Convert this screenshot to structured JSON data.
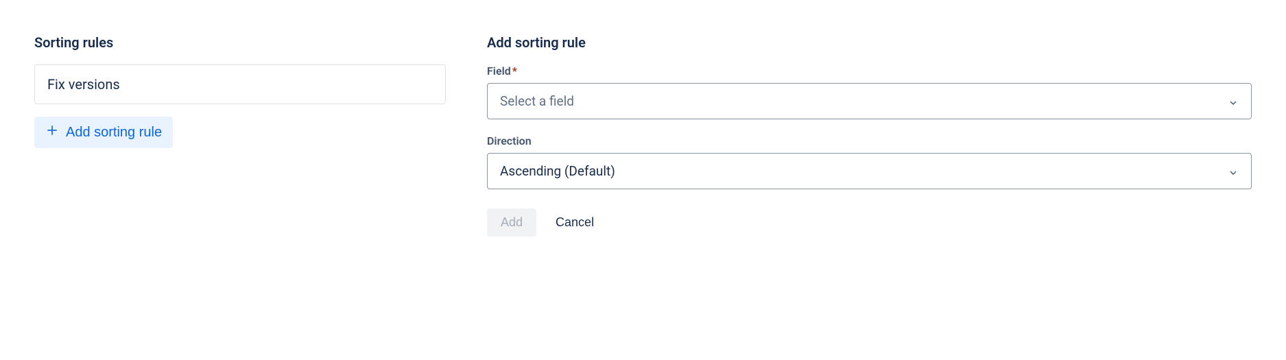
{
  "left": {
    "heading": "Sorting rules",
    "rules": [
      {
        "label": "Fix versions"
      }
    ],
    "addButtonLabel": "Add sorting rule"
  },
  "right": {
    "heading": "Add sorting rule",
    "fieldLabel": "Field",
    "fieldRequired": "*",
    "fieldPlaceholder": "Select a field",
    "directionLabel": "Direction",
    "directionValue": "Ascending (Default)",
    "addButtonLabel": "Add",
    "cancelButtonLabel": "Cancel"
  }
}
